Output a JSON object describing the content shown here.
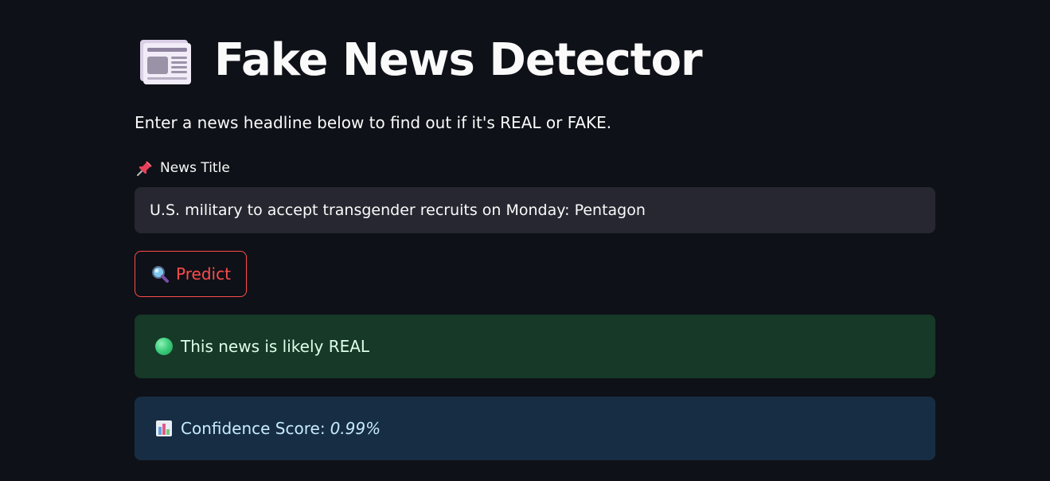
{
  "header": {
    "title": "Fake News Detector",
    "icon": "newspaper-icon"
  },
  "subtitle": "Enter a news headline below to find out if it's REAL or FAKE.",
  "form": {
    "label": "News Title",
    "label_icon": "pushpin-icon",
    "input_value": "U.S. military to accept transgender recruits on Monday: Pentagon",
    "button_label": "Predict",
    "button_icon": "magnifying-glass-icon"
  },
  "result": {
    "prediction_icon": "green-circle-icon",
    "prediction_text": "This news is likely REAL",
    "confidence_icon": "bar-chart-icon",
    "confidence_label": "Confidence Score:",
    "confidence_value": "0.99%"
  },
  "colors": {
    "background": "#0e1117",
    "accent": "#ff4b4b",
    "success_bg": "#173928",
    "info_bg": "#172d43",
    "input_bg": "#262730"
  }
}
